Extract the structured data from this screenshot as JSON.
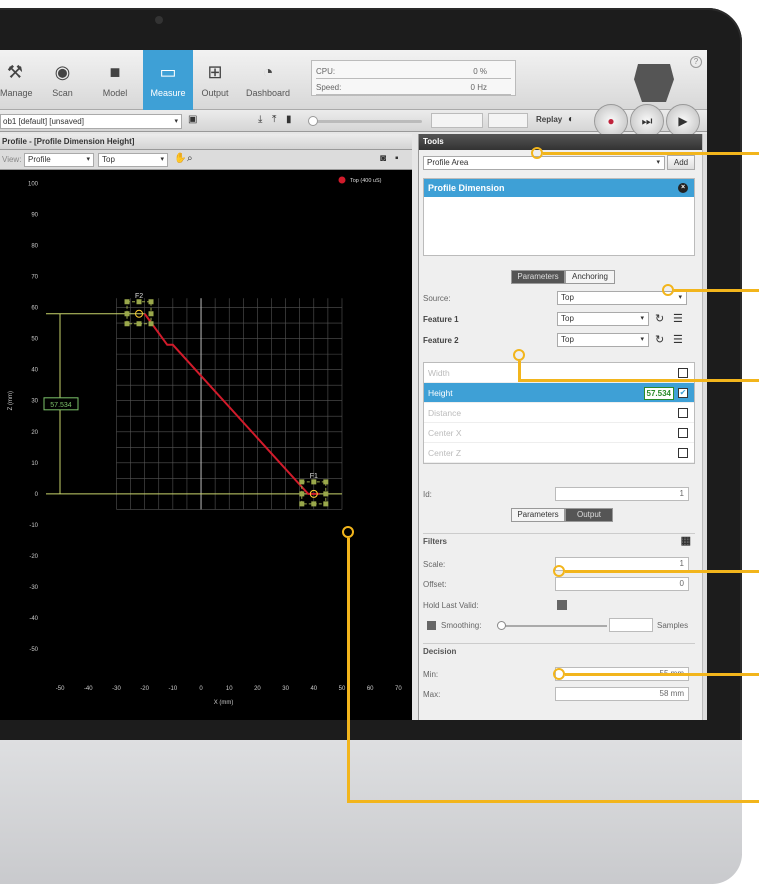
{
  "toolbar": {
    "items": [
      {
        "label": "Manage",
        "icon": "wrench-icon"
      },
      {
        "label": "Scan",
        "icon": "scan-icon"
      },
      {
        "label": "Model",
        "icon": "cube-icon"
      },
      {
        "label": "Measure",
        "icon": "ruler-icon"
      },
      {
        "label": "Output",
        "icon": "network-icon"
      },
      {
        "label": "Dashboard",
        "icon": "gauge-icon"
      }
    ],
    "meters": {
      "cpu_label": "CPU:",
      "cpu_value": "0 %",
      "speed_label": "Speed:",
      "speed_value": "0 Hz"
    }
  },
  "jobbar": {
    "job": "ob1 [default] [unsaved]",
    "replay_label": "Replay"
  },
  "left_panel": {
    "title": "Profile - [Profile Dimension Height]",
    "view_label": "View:",
    "view_value": "Profile",
    "source_value": "Top"
  },
  "chart_data": {
    "type": "line",
    "xlabel": "X (mm)",
    "ylabel": "Z (mm)",
    "xlim": [
      -55,
      72
    ],
    "ylim": [
      -58,
      103
    ],
    "x_ticks": [
      -50,
      -40,
      -30,
      -20,
      -10,
      0,
      10,
      20,
      30,
      40,
      50,
      60,
      70
    ],
    "y_ticks": [
      100,
      90,
      80,
      70,
      60,
      50,
      40,
      30,
      20,
      10,
      0,
      -10,
      -20,
      -30,
      -40,
      -50
    ],
    "legend": {
      "name": "Top (400 uS)",
      "position": "top-right",
      "color": "#d11b2b"
    },
    "series": [
      {
        "name": "Top (400 uS)",
        "x": [
          -20,
          -12,
          -10,
          38,
          42
        ],
        "y": [
          58,
          48,
          48,
          0,
          0
        ]
      }
    ],
    "features": [
      {
        "label": "F2",
        "x": -22,
        "y": 58
      },
      {
        "label": "F1",
        "x": 40,
        "y": 0
      }
    ],
    "dimension_label": "57.534",
    "grid": true
  },
  "tools": {
    "title": "Tools",
    "tool_select": "Profile Area",
    "add_label": "Add",
    "selected_tool": "Profile Dimension",
    "tabs1": [
      "Parameters",
      "Anchoring"
    ],
    "source_label": "Source:",
    "source_value": "Top",
    "feature1_label": "Feature 1",
    "feature1_value": "Top",
    "feature2_label": "Feature 2",
    "feature2_value": "Top",
    "measurements": [
      {
        "label": "Width",
        "checked": false
      },
      {
        "label": "Height",
        "checked": true,
        "value": "57.534"
      },
      {
        "label": "Distance",
        "checked": false
      },
      {
        "label": "Center X",
        "checked": false
      },
      {
        "label": "Center Z",
        "checked": false
      }
    ],
    "id_label": "Id:",
    "id_value": "1",
    "tabs2": [
      "Parameters",
      "Output"
    ],
    "filters_label": "Filters",
    "scale_label": "Scale:",
    "scale_value": "1",
    "offset_label": "Offset:",
    "offset_value": "0",
    "hold_label": "Hold Last Valid:",
    "smoothing_label": "Smoothing:",
    "samples_label": "Samples",
    "decision_label": "Decision",
    "min_label": "Min:",
    "min_value": "55",
    "min_unit": "mm",
    "max_label": "Max:",
    "max_value": "58",
    "max_unit": "mm"
  },
  "colors": {
    "accent": "#3ea0d6",
    "callout": "#f2b51c",
    "profile": "#d11b2b",
    "feature": "#9aa84b"
  }
}
